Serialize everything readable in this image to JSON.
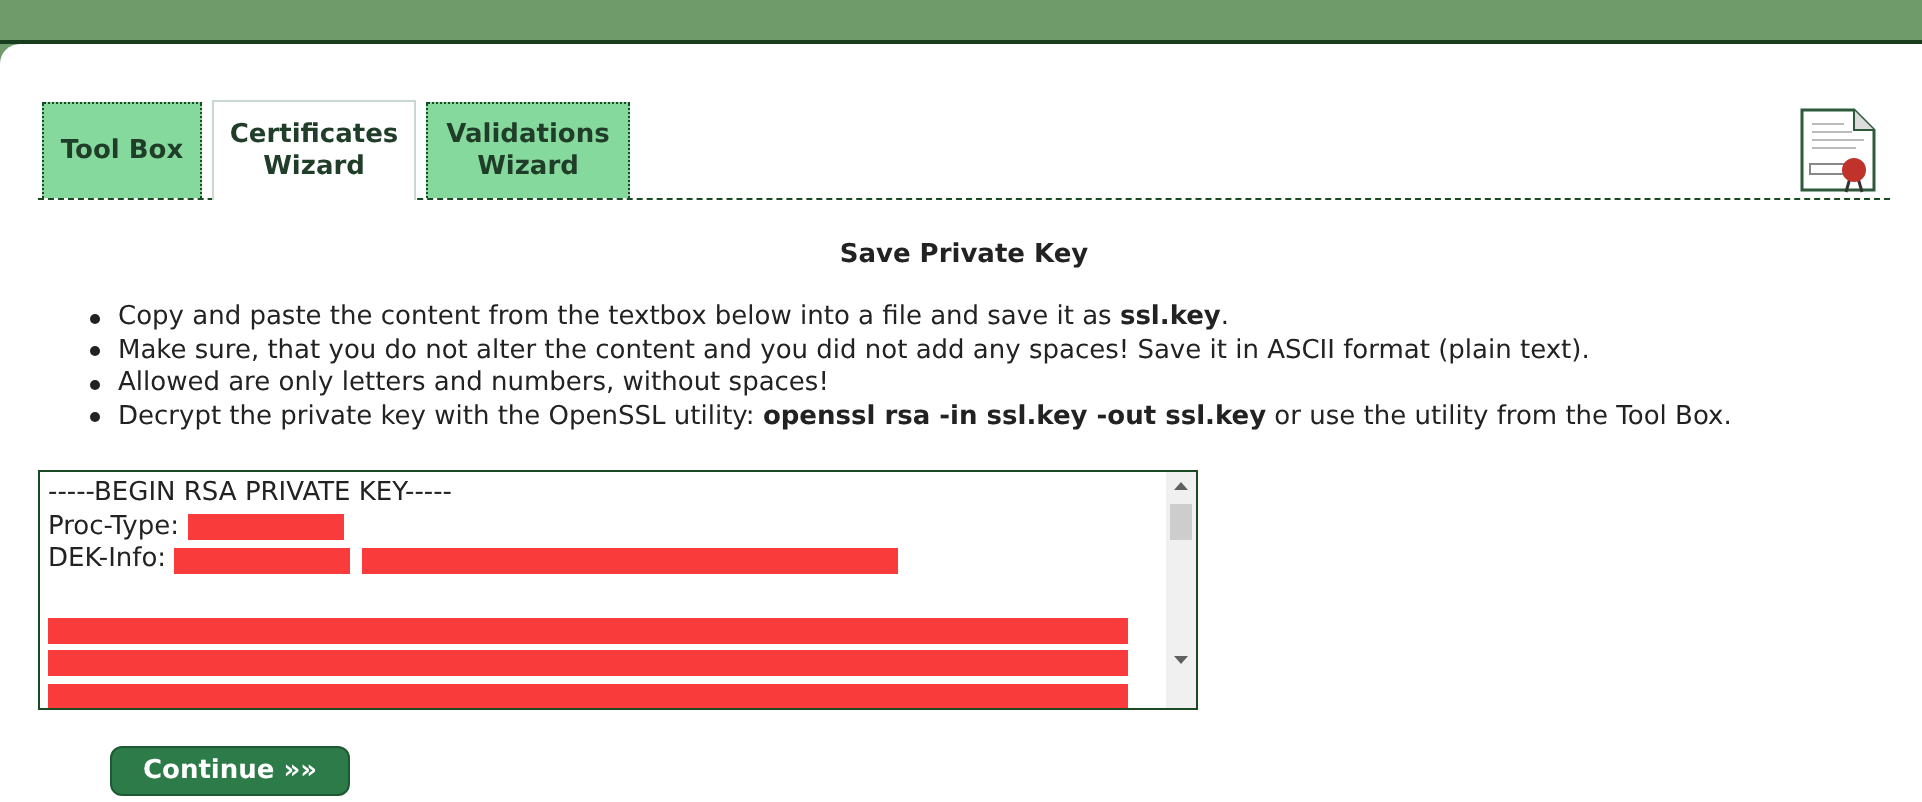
{
  "tabs": [
    {
      "label": "Tool Box",
      "selected": false
    },
    {
      "label": "Certificates Wizard",
      "selected": true
    },
    {
      "label": "Validations Wizard",
      "selected": false
    }
  ],
  "heading": "Save Private Key",
  "instructions": [
    "Copy and paste the content from the textbox below into a file and save it as **ssl.key**.",
    "Make sure, that you do not alter the content and you did not add any spaces! Save it in ASCII format (plain text).",
    "Allowed are only letters and numbers, without spaces!",
    "Decrypt the private key with the OpenSSL utility: **openssl rsa -in ssl.key -out ssl.key** or use the utility from the Tool Box."
  ],
  "key_textbox": {
    "lines": [
      {
        "kind": "text",
        "text": "-----BEGIN RSA PRIVATE KEY-----"
      },
      {
        "kind": "field",
        "text": "Proc-Type:"
      },
      {
        "kind": "field2",
        "text": "DEK-Info:"
      },
      {
        "kind": "blank"
      },
      {
        "kind": "redacted"
      },
      {
        "kind": "redacted"
      },
      {
        "kind": "redacted"
      }
    ]
  },
  "continue_button": "Continue »»"
}
